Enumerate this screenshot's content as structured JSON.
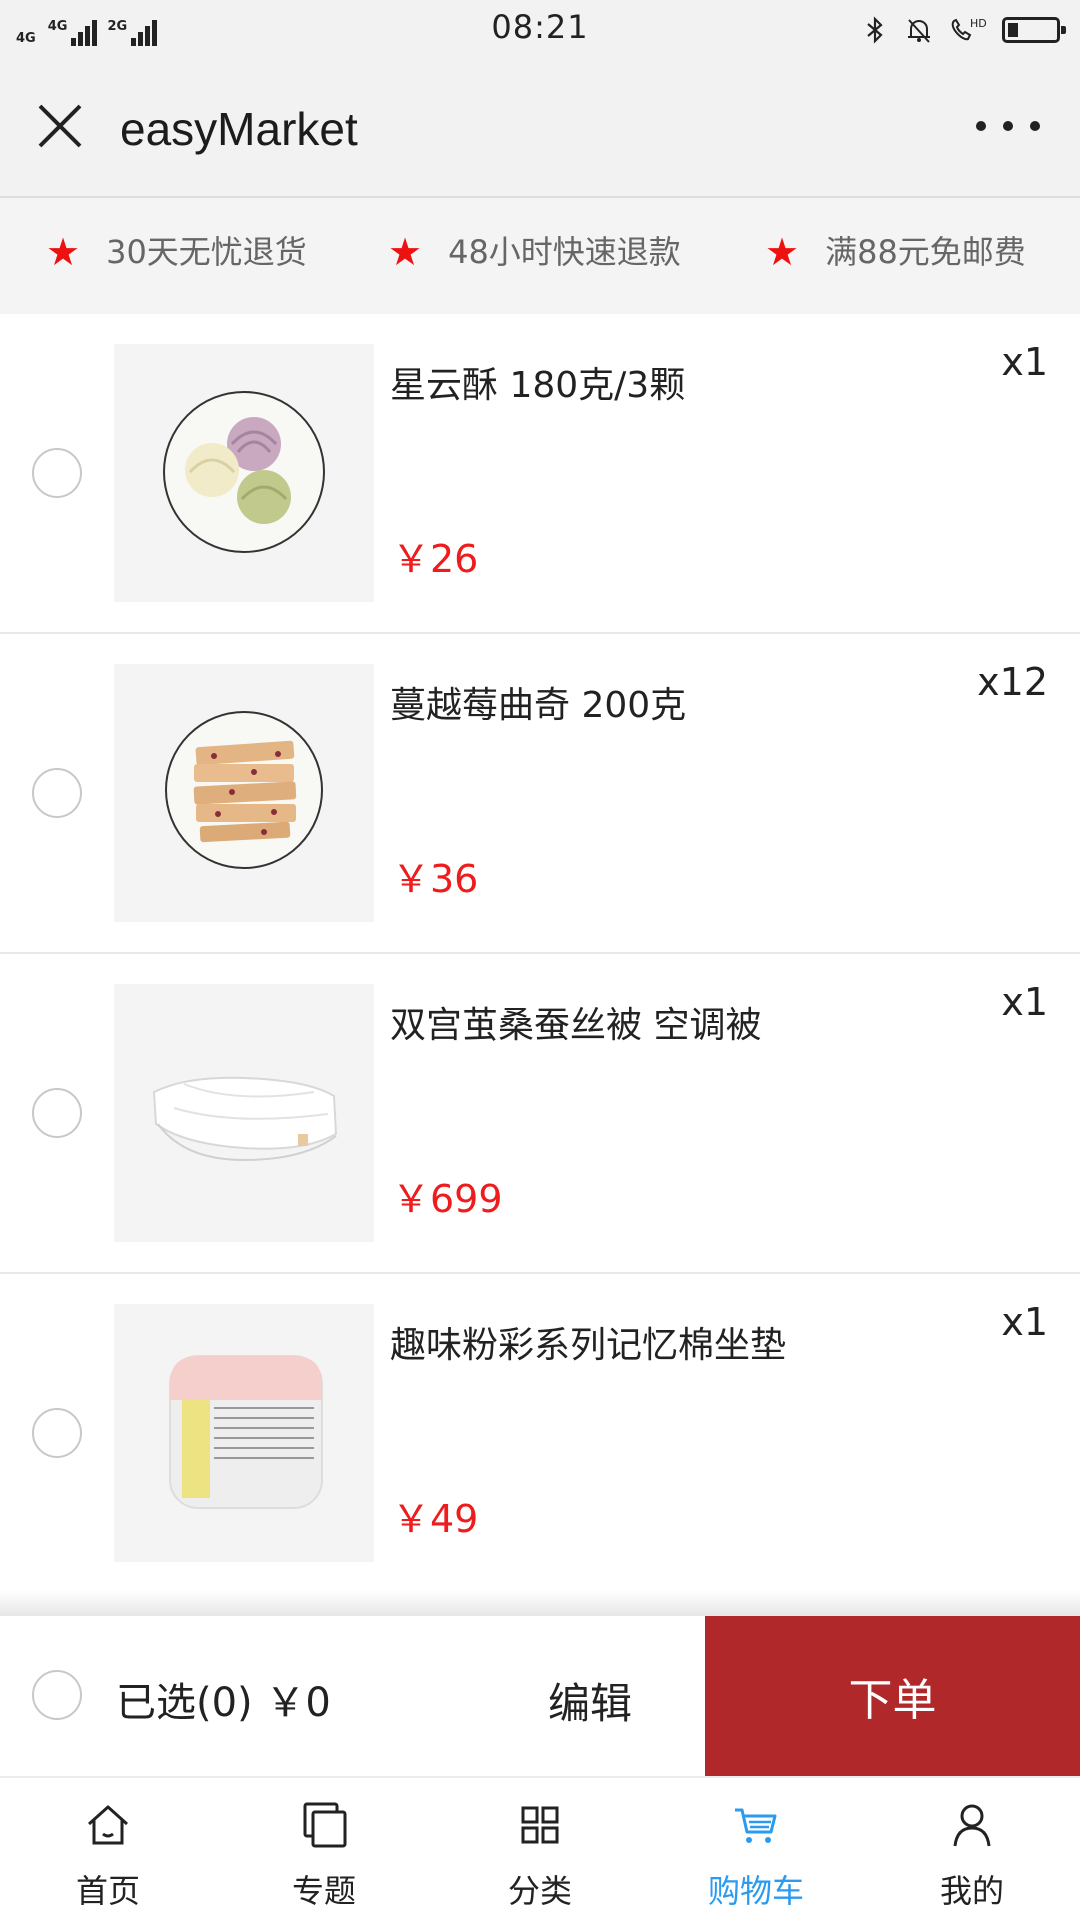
{
  "status_bar": {
    "network_1": "4G",
    "network_2": "4G",
    "network_3": "2G",
    "time": "08:21",
    "icons": [
      "bluetooth-icon",
      "alarm-icon",
      "hd-call-icon",
      "battery-icon"
    ],
    "hd_label": "HD"
  },
  "title_bar": {
    "title": "easyMarket"
  },
  "promises": [
    {
      "icon": "star-icon",
      "text": "30天无忧退货"
    },
    {
      "icon": "star-icon",
      "text": "48小时快速退款"
    },
    {
      "icon": "star-icon",
      "text": "满88元免邮费"
    }
  ],
  "cart": {
    "items": [
      {
        "name": "星云酥 180克/3颗",
        "price": "￥26",
        "qty": "x1",
        "image": "pastry-plate-image",
        "checked": false
      },
      {
        "name": "蔓越莓曲奇 200克",
        "price": "￥36",
        "qty": "x12",
        "image": "cookie-plate-image",
        "checked": false
      },
      {
        "name": "双宫茧桑蚕丝被 空调被",
        "price": "￥699",
        "qty": "x1",
        "image": "silk-quilt-image",
        "checked": false
      },
      {
        "name": "趣味粉彩系列记忆棉坐垫",
        "price": "￥49",
        "qty": "x1",
        "image": "memory-foam-cushion-image",
        "checked": false
      }
    ]
  },
  "checkout": {
    "selected_label": "已选(0) ￥0",
    "edit_label": "编辑",
    "order_label": "下单"
  },
  "tab_bar": {
    "tabs": [
      {
        "label": "首页",
        "icon": "home-icon",
        "active": false
      },
      {
        "label": "专题",
        "icon": "topics-icon",
        "active": false
      },
      {
        "label": "分类",
        "icon": "category-grid-icon",
        "active": false
      },
      {
        "label": "购物车",
        "icon": "cart-icon",
        "active": true
      },
      {
        "label": "我的",
        "icon": "user-icon",
        "active": false
      }
    ]
  },
  "colors": {
    "price": "#ee1c1c",
    "star": "#ee1111",
    "order_button": "#b0282a",
    "active_tab": "#2a9bf0"
  }
}
